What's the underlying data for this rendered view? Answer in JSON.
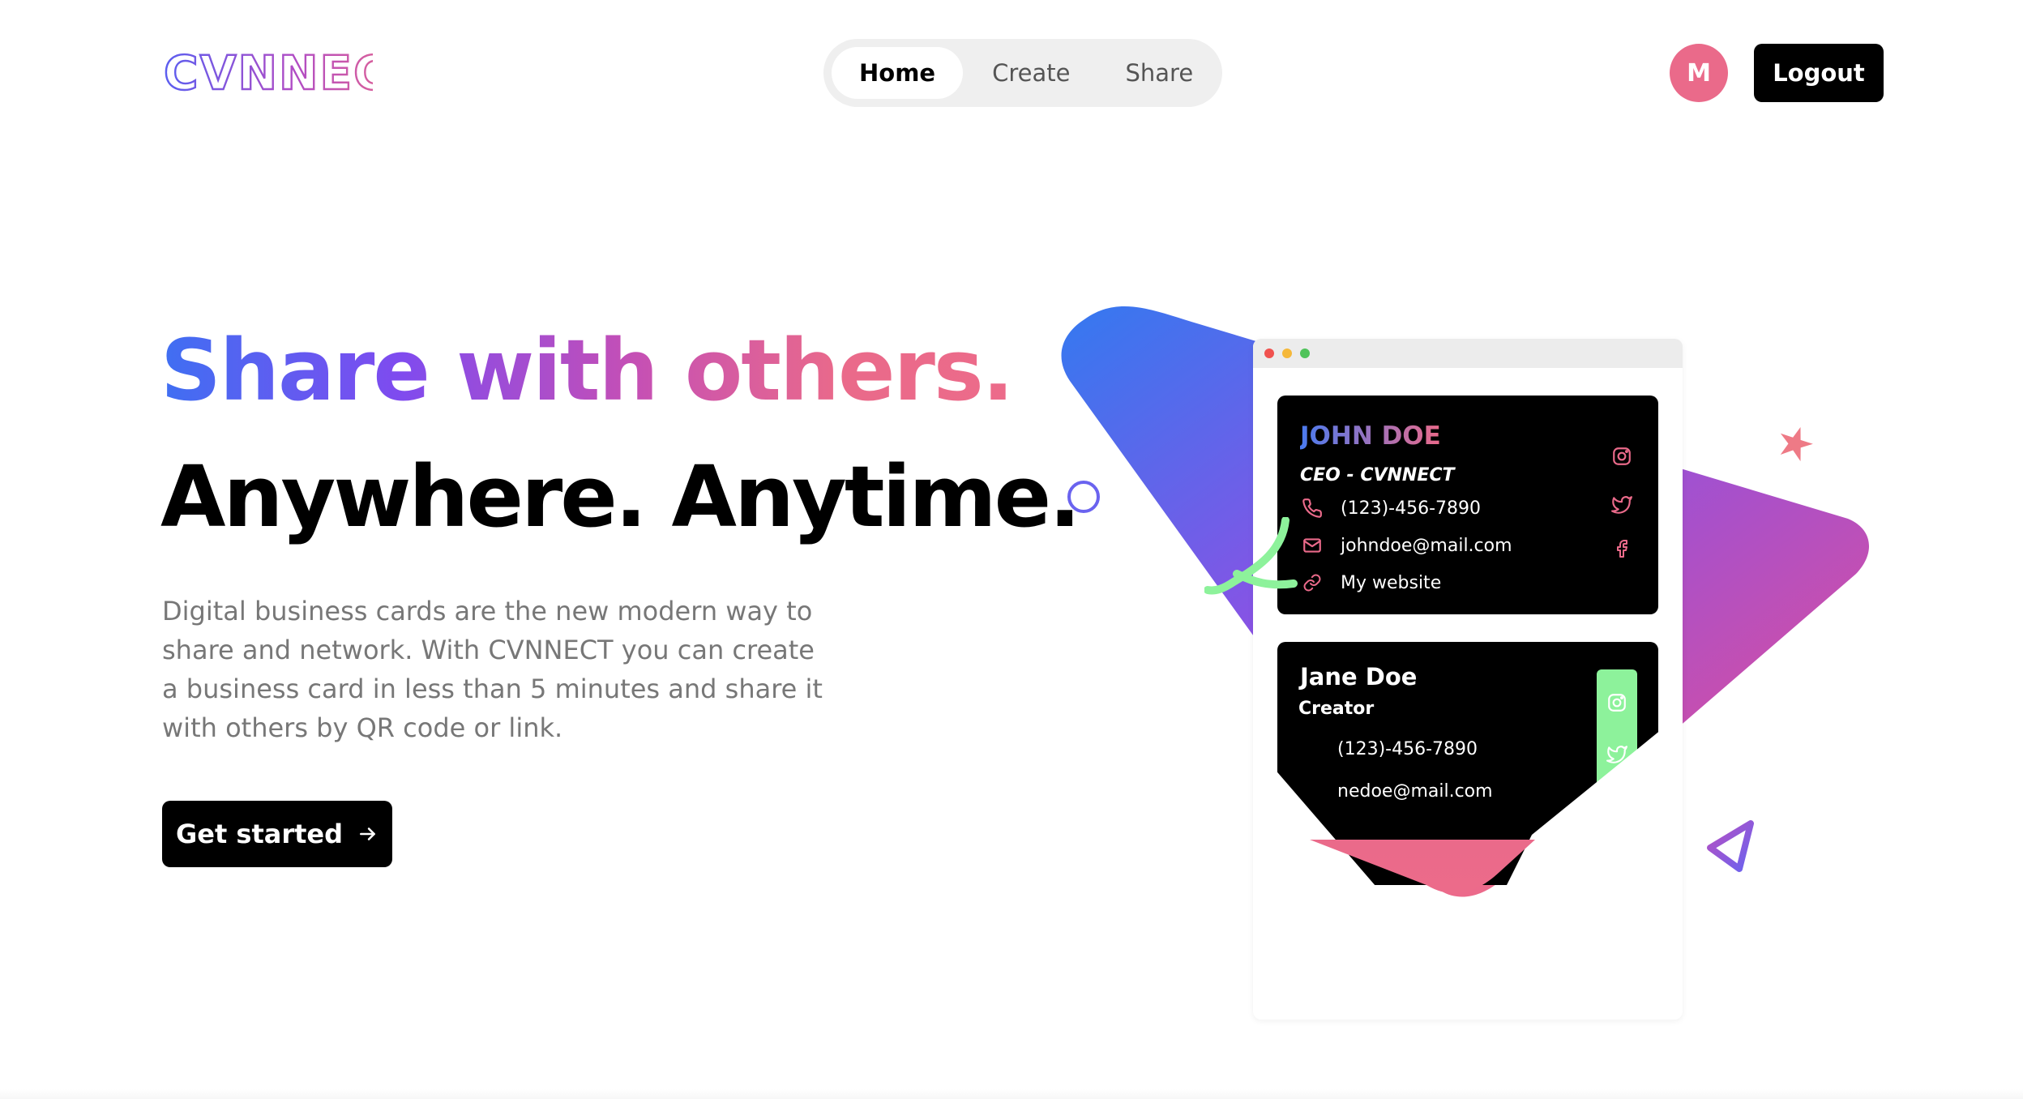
{
  "header": {
    "logo_text": "CVNNECT",
    "nav": [
      {
        "label": "Home",
        "active": true
      },
      {
        "label": "Create",
        "active": false
      },
      {
        "label": "Share",
        "active": false
      }
    ],
    "avatar_initial": "M",
    "logout_label": "Logout"
  },
  "hero": {
    "headline_gradient": "Share with others.",
    "headline_black": "Anywhere. Anytime.",
    "description": "Digital business cards are the new modern way to share and network. With CVNNECT you can create a business card in less than 5 minutes and share it with others by QR code or link.",
    "cta_label": "Get started"
  },
  "illustration": {
    "card1": {
      "name": "JOHN DOE",
      "role": "CEO - CVNNECT",
      "phone": "(123)-456-7890",
      "email": "johndoe@mail.com",
      "website": "My website",
      "icons": [
        "phone-icon",
        "mail-icon",
        "link-icon",
        "instagram-icon",
        "twitter-icon",
        "facebook-icon"
      ]
    },
    "card2": {
      "name": "Jane Doe",
      "role": "Creator",
      "phone": "(123)-456-7890",
      "email": "nedoe@mail.com",
      "icons": [
        "instagram-icon",
        "twitter-icon"
      ]
    }
  },
  "colors": {
    "gradient_blue": "#3f6ff2",
    "gradient_purple": "#7f4bef",
    "gradient_pink": "#ea6a8a",
    "accent_green": "#8df29b",
    "dark": "#000000"
  }
}
